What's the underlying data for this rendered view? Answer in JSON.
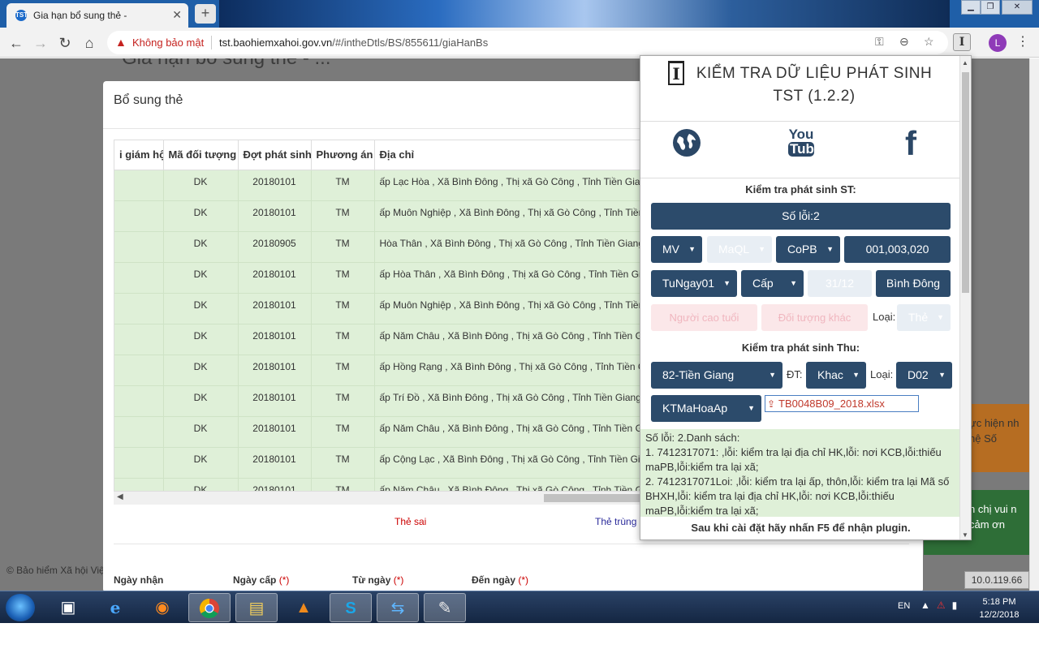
{
  "browser": {
    "tab_title": "Gia hạn bổ sung thẻ -",
    "tab_favicon": "TST",
    "security_label": "Không bảo mật",
    "url_host": "tst.baohiemxahoi.gov.vn",
    "url_path": "/#/intheDtls/BS/855611/giaHanBs",
    "profile_initial": "L",
    "extension_letter": "I"
  },
  "page": {
    "bg_title": "Gia hạn bổ sung thẻ - ...",
    "copyright": "© Bảo hiểm Xã hội Việ",
    "ip_badge": "10.0.119.66",
    "toast1": "ực hiện nh hệ Số",
    "toast2": "n chị vui n cảm ơn"
  },
  "modal": {
    "title": "Bổ sung thẻ",
    "columns": [
      "i giám hộ",
      "Mã đối tượng",
      "Đợt phát sinh",
      "Phương án",
      "Địa chỉ"
    ],
    "rows": [
      [
        "",
        "DK",
        "20180101",
        "TM",
        "ấp Lạc Hòa , Xã Bình Đông , Thị xã Gò Công , Tỉnh Tiền Giang"
      ],
      [
        "",
        "DK",
        "20180101",
        "TM",
        "ấp Muôn Nghiệp , Xã Bình Đông , Thị xã Gò Công , Tỉnh Tiền Giang"
      ],
      [
        "",
        "DK",
        "20180905",
        "TM",
        "Hòa Thân , Xã Bình Đông , Thị xã Gò Công , Tỉnh Tiền Giang"
      ],
      [
        "",
        "DK",
        "20180101",
        "TM",
        "ấp Hòa Thân , Xã Bình Đông , Thị xã Gò Công , Tỉnh Tiền Giang"
      ],
      [
        "",
        "DK",
        "20180101",
        "TM",
        "ấp Muôn Nghiệp , Xã Bình Đông , Thị xã Gò Công , Tỉnh Tiền Giang"
      ],
      [
        "",
        "DK",
        "20180101",
        "TM",
        "ấp Năm Châu , Xã Bình Đông , Thị xã Gò Công , Tỉnh Tiền Giang"
      ],
      [
        "",
        "DK",
        "20180101",
        "TM",
        "ấp Hồng Rạng , Xã Bình Đông , Thị xã Gò Công , Tỉnh Tiền Giang"
      ],
      [
        "",
        "DK",
        "20180101",
        "TM",
        "ấp Trí Đồ , Xã Bình Đông , Thị xã Gò Công , Tỉnh Tiền Giang"
      ],
      [
        "",
        "DK",
        "20180101",
        "TM",
        "ấp Năm Châu , Xã Bình Đông , Thị xã Gò Công , Tỉnh Tiền Giang"
      ],
      [
        "",
        "DK",
        "20180101",
        "TM",
        "ấp Cộng Lạc , Xã Bình Đông , Thị xã Gò Công , Tỉnh Tiền Giang"
      ],
      [
        "",
        "DK",
        "20180101",
        "TM",
        "ấp Năm Châu , Xã Bình Đông , Thị xã Gò Công , Tỉnh Tiền Giang"
      ]
    ],
    "label_wrong": "Thẻ sai",
    "label_dup": "Thẻ trùng",
    "fields": {
      "ngay_nhan": "Ngày nhận",
      "ngay_cap": "Ngày cấp",
      "tu_ngay": "Từ ngày",
      "den_ngay": "Đến ngày",
      "required": "(*)"
    }
  },
  "popup": {
    "title": "KIỂM TRA DỮ LIỆU PHÁT SINH TST (1.2.2)",
    "youtube_top": "You",
    "youtube_bottom": "Tube",
    "facebook": "f",
    "section_st": "Kiểm tra phát sinh ST:",
    "error_count_btn": "Số lỗi:2",
    "row1": {
      "mv": "MV",
      "maql": "MaQL",
      "copb": "CoPB",
      "code": "001,003,020"
    },
    "row2": {
      "tungay": "TuNgay01",
      "cap": "Cấp",
      "date": "31/12",
      "place": "Bình Đông"
    },
    "row3": {
      "nguoi_cao_tuoi": "Người cao tuổi",
      "doi_tuong_khac": "Đối tượng khác",
      "loai_label": "Loại:",
      "loai_value": "Thẻ"
    },
    "section_thu": "Kiểm tra phát sinh Thu:",
    "row4": {
      "province": "82-Tiền Giang",
      "dt_label": "ĐT:",
      "dt_value": "Khac",
      "loai_label": "Loại:",
      "loai_value": "D02"
    },
    "row5": {
      "method": "KTMaHoaAp",
      "file": "TB0048B09_2018.xlsx"
    },
    "errors": [
      "Số lỗi: 2.Danh sách:",
      "1. 7412317071: ,lỗi: kiểm tra lại địa chỉ HK,lỗi: nơi KCB,lỗi:thiếu maPB,lỗi:kiểm tra lại xã;",
      "2. 7412317071Loi: ,lỗi: kiểm tra lại ấp, thôn,lỗi: kiểm tra lại Mã số BHXH,lỗi: kiểm tra lại địa chỉ HK,lỗi: nơi KCB,lỗi:thiếu maPB,lỗi:kiểm tra lại xã;"
    ],
    "hint": "Sau khi cài đặt hãy nhấn F5 để nhận plugin."
  },
  "taskbar": {
    "lang": "EN",
    "time": "5:18 PM",
    "date": "12/2/2018"
  }
}
